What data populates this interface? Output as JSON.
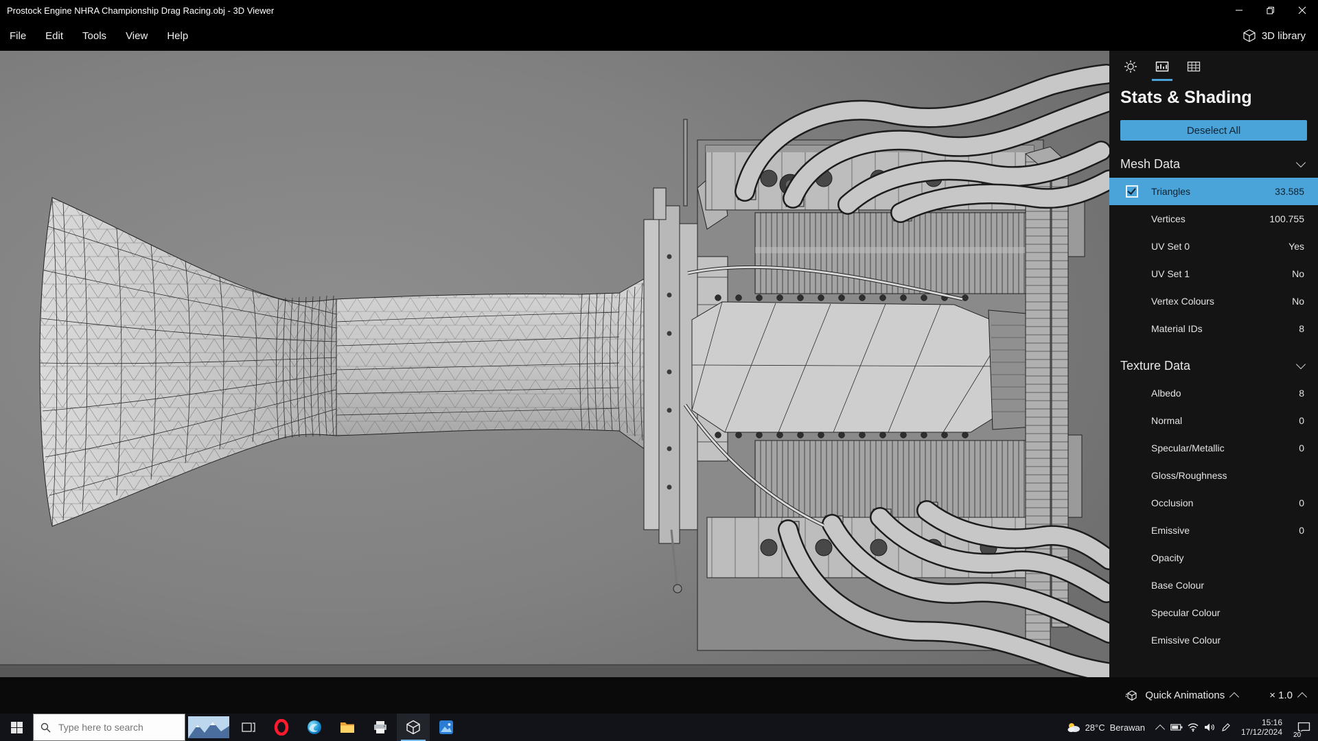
{
  "window": {
    "title": "Prostock Engine NHRA Championship Drag Racing.obj - 3D Viewer"
  },
  "menubar": {
    "items": [
      "File",
      "Edit",
      "Tools",
      "View",
      "Help"
    ],
    "library": "3D library"
  },
  "panel": {
    "title": "Stats & Shading",
    "deselect": "Deselect All",
    "sections": [
      {
        "label": "Mesh Data",
        "rows": [
          {
            "label": "Triangles",
            "value": "33.585"
          },
          {
            "label": "Vertices",
            "value": "100.755"
          },
          {
            "label": "UV Set 0",
            "value": "Yes"
          },
          {
            "label": "UV Set 1",
            "value": "No"
          },
          {
            "label": "Vertex Colours",
            "value": "No"
          },
          {
            "label": "Material IDs",
            "value": "8"
          }
        ]
      },
      {
        "label": "Texture Data",
        "rows": [
          {
            "label": "Albedo",
            "value": "8"
          },
          {
            "label": "Normal",
            "value": "0"
          },
          {
            "label": "Specular/Metallic",
            "value": "0"
          },
          {
            "label": "Gloss/Roughness",
            "value": ""
          },
          {
            "label": "Occlusion",
            "value": "0"
          },
          {
            "label": "Emissive",
            "value": "0"
          },
          {
            "label": "Opacity",
            "value": ""
          },
          {
            "label": "Base Colour",
            "value": ""
          },
          {
            "label": "Specular Colour",
            "value": ""
          },
          {
            "label": "Emissive Colour",
            "value": ""
          }
        ]
      }
    ]
  },
  "bottom_bar": {
    "quick_animations": "Quick Animations",
    "scale": "× 1.0"
  },
  "taskbar": {
    "search_placeholder": "Type here to search",
    "weather_temp": "28°C",
    "weather_condition": "Berawan",
    "time": "15:16",
    "date": "17/12/2024",
    "notification_count": "20"
  },
  "colors": {
    "accent": "#4aa3d9",
    "viewport_bg": "#7e7e7e",
    "panel_bg": "#141414",
    "selected_text": "#0c2230"
  }
}
